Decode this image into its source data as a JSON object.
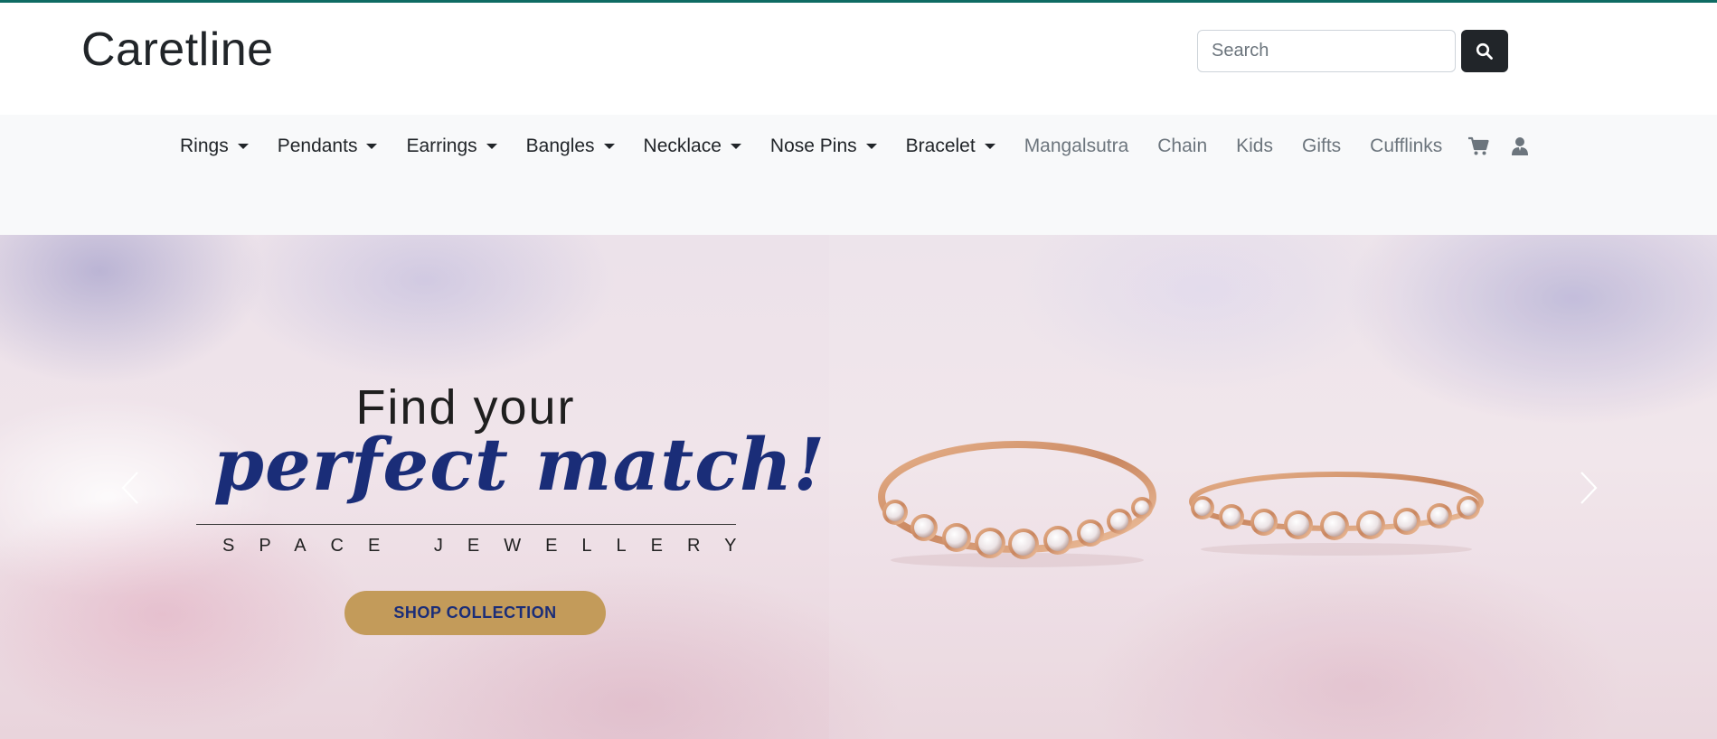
{
  "brand": {
    "name": "Caretline",
    "accent_color": "#0f6b63"
  },
  "search": {
    "placeholder": "Search",
    "button_icon": "search-icon"
  },
  "nav": {
    "dropdown_items": [
      {
        "label": "Rings"
      },
      {
        "label": "Pendants"
      },
      {
        "label": "Earrings"
      },
      {
        "label": "Bangles"
      },
      {
        "label": "Necklace"
      },
      {
        "label": "Nose Pins"
      },
      {
        "label": "Bracelet"
      }
    ],
    "plain_items": [
      {
        "label": "Mangalsutra"
      },
      {
        "label": "Chain"
      },
      {
        "label": "Kids"
      },
      {
        "label": "Gifts"
      },
      {
        "label": "Cufflinks"
      }
    ],
    "icons": [
      "cart-icon",
      "user-icon"
    ]
  },
  "hero": {
    "headline_line1": "Find your",
    "headline_line2": "perfect match!",
    "tagline": "SPACE JEWELLERY",
    "cta_label": "SHOP COLLECTION",
    "cta_color": "#c39b5a",
    "headline_color": "#1a2d78",
    "prev_icon": "chevron-left-icon",
    "next_icon": "chevron-right-icon"
  }
}
